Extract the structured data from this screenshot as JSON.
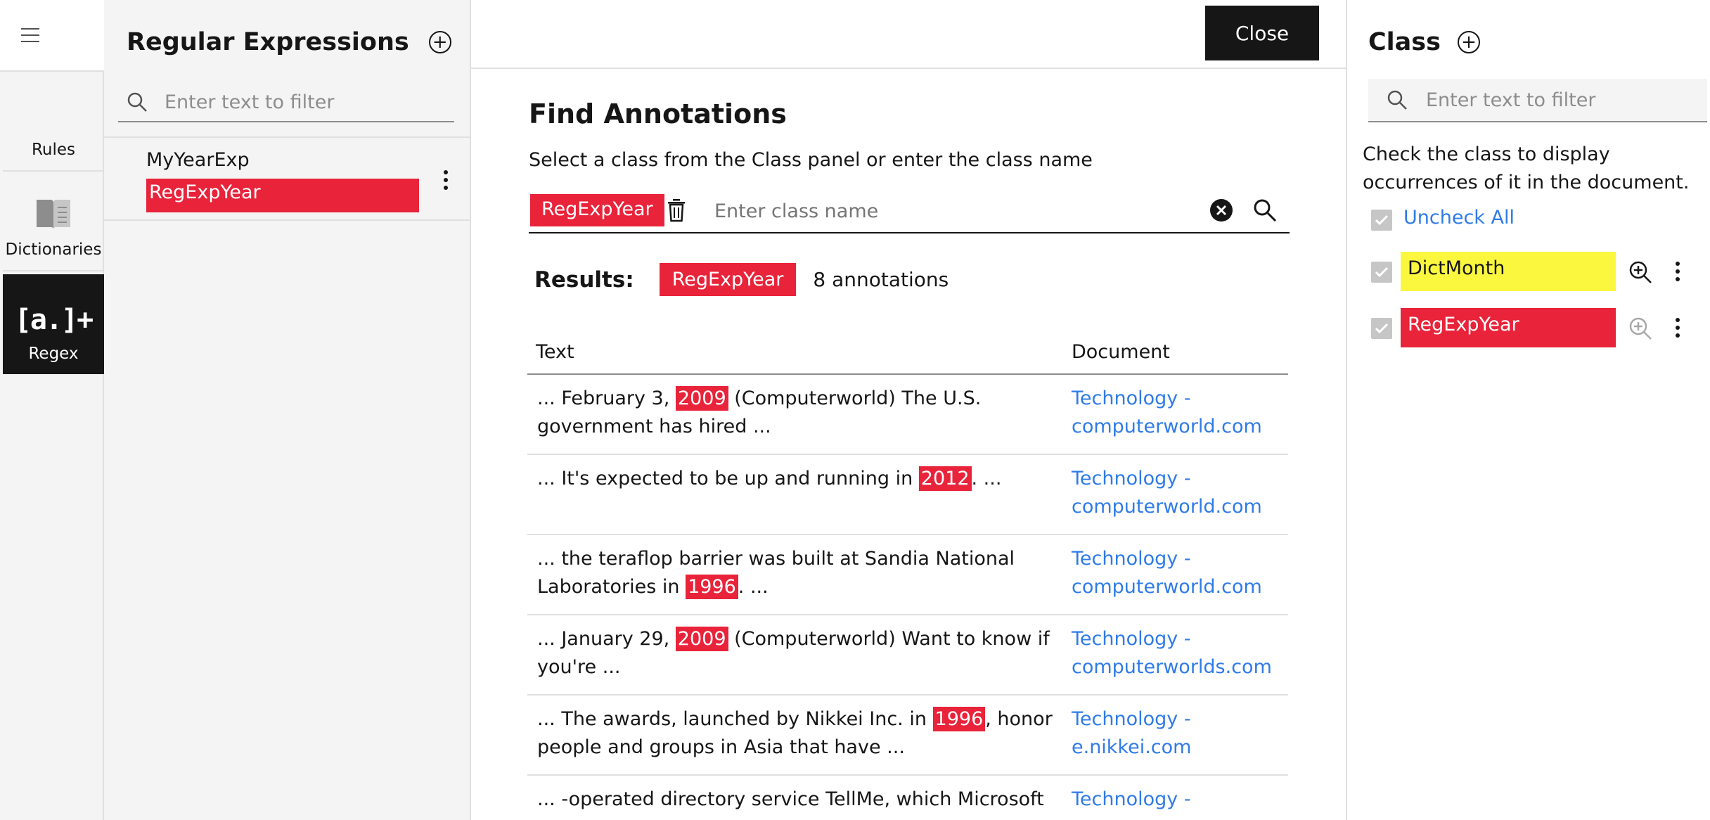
{
  "rail": {
    "items": [
      {
        "label": "Rules",
        "icon": "rules-icon",
        "active": false
      },
      {
        "label": "Dictionaries",
        "icon": "book-icon",
        "active": false
      },
      {
        "label": "Regex",
        "icon": "regex-icon",
        "active": true
      }
    ]
  },
  "regex_panel": {
    "title": "Regular Expressions",
    "filter_placeholder": "Enter text to filter",
    "item": {
      "name": "MyYearExp",
      "class_tag": "RegExpYear"
    }
  },
  "main": {
    "close_label": "Close",
    "title": "Find Annotations",
    "subtitle": "Select a class from the Class panel or enter the class name",
    "selected_class": "RegExpYear",
    "class_input_placeholder": "Enter class name",
    "results_label": "Results:",
    "results_tag": "RegExpYear",
    "results_count": "8 annotations",
    "table": {
      "headers": [
        "Text",
        "Document"
      ],
      "rows": [
        {
          "pre": "... February 3, ",
          "hl": "2009",
          "post": " (Computerworld) The U.S. government has hired ...",
          "doc1": "Technology -",
          "doc2": "computerworld.com"
        },
        {
          "pre": "... It's expected to be up and running in ",
          "hl": "2012",
          "post": ". ...",
          "doc1": "Technology -",
          "doc2": "computerworld.com"
        },
        {
          "pre": "... the teraflop barrier was built at Sandia National Laboratories in ",
          "hl": "1996",
          "post": ". ...",
          "doc1": "Technology -",
          "doc2": "computerworld.com"
        },
        {
          "pre": "... January 29, ",
          "hl": "2009",
          "post": " (Computerworld) Want to know if you're ...",
          "doc1": "Technology -",
          "doc2": "computerworlds.com"
        },
        {
          "pre": "... The awards, launched by Nikkei Inc. in ",
          "hl": "1996",
          "post": ", honor people and groups in Asia that have ...",
          "doc1": "Technology -",
          "doc2": "e.nikkei.com"
        },
        {
          "pre": "... -operated directory service TellMe, which Microsoft",
          "hl": "",
          "post": "",
          "doc1": "Technology -",
          "doc2": ""
        }
      ]
    }
  },
  "class_panel": {
    "title": "Class",
    "filter_placeholder": "Enter text to filter",
    "help": "Check the class to display occurrences of it in the document.",
    "uncheck_all": "Uncheck All",
    "classes": [
      {
        "name": "DictMonth",
        "color": "#fbf73f"
      },
      {
        "name": "RegExpYear",
        "color": "#e8233a"
      }
    ]
  },
  "colors": {
    "accent_red": "#e8233a",
    "highlight_yellow": "#fbf73f",
    "link_blue": "#2f7be8"
  }
}
